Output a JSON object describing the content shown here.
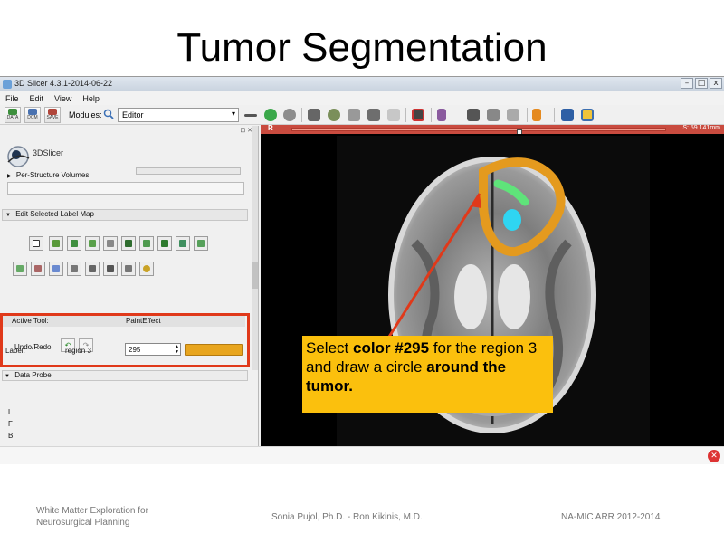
{
  "slide": {
    "title": "Tumor Segmentation",
    "footer_left_line1": "White Matter Exploration for",
    "footer_left_line2": "Neurosurgical Planning",
    "footer_center": "Sonia Pujol, Ph.D. - Ron Kikinis, M.D.",
    "footer_right": "NA-MIC ARR 2012-2014"
  },
  "window": {
    "title": "3D Slicer 4.3.1-2014-06-22",
    "minimize": "–",
    "maximize": "□",
    "close": "x"
  },
  "menu": [
    "File",
    "Edit",
    "View",
    "Help"
  ],
  "toolbar": {
    "data_label": "DATA",
    "dcm_label": "DCM",
    "save_label": "SAVE",
    "modules_label": "Modules:",
    "module_selected": "Editor"
  },
  "panel": {
    "logo_text": "3DSlicer",
    "per_structure_volumes": "Per-Structure Volumes",
    "edit_selected_label_map": "Edit Selected Label Map",
    "undo_redo_label": "Undo/Redo:",
    "active_tool_label": "Active Tool:",
    "active_tool_value": "PaintEffect",
    "label_label": "Label:",
    "label_name": "region 3",
    "label_number": "295",
    "label_color": "#e8a51e",
    "data_probe": "Data Probe",
    "orientation": [
      "L",
      "F",
      "B"
    ]
  },
  "view": {
    "orientation_label": "R",
    "slice_offset": "S: 59.141mm"
  },
  "callout": {
    "text1": "Select ",
    "bold1": "color #295",
    "text2": " for the region 3 and draw a circle ",
    "bold2": "around the tumor.",
    "bg": "#fbc00d"
  }
}
